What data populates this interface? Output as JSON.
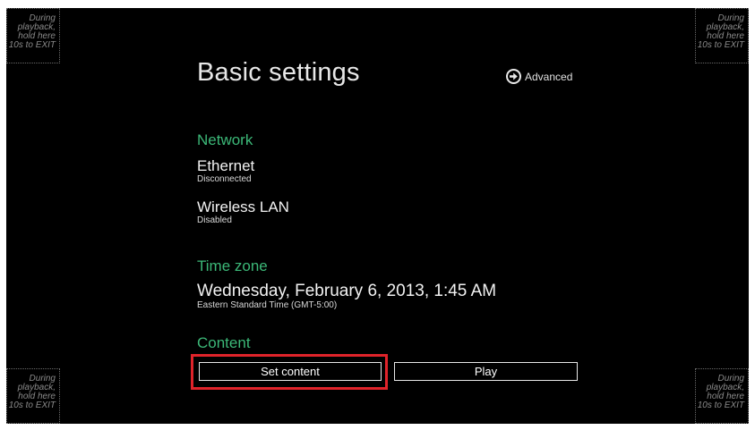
{
  "corner_hint": {
    "lines": [
      "During",
      "playback,",
      "hold here",
      "10s to EXIT"
    ]
  },
  "header": {
    "title": "Basic settings",
    "advanced_label": "Advanced"
  },
  "network": {
    "section_label": "Network",
    "ethernet": {
      "label": "Ethernet",
      "status": "Disconnected"
    },
    "wireless": {
      "label": "Wireless LAN",
      "status": "Disabled"
    }
  },
  "time_zone": {
    "section_label": "Time zone",
    "datetime": "Wednesday, February 6, 2013, 1:45 AM",
    "zone": "Eastern Standard Time (GMT-5:00)"
  },
  "content": {
    "section_label": "Content",
    "set_content_label": "Set content",
    "play_label": "Play"
  },
  "colors": {
    "background": "#000000",
    "section_heading": "#3cb878",
    "text": "#f2f2f2",
    "highlight_box": "#e0232a"
  }
}
